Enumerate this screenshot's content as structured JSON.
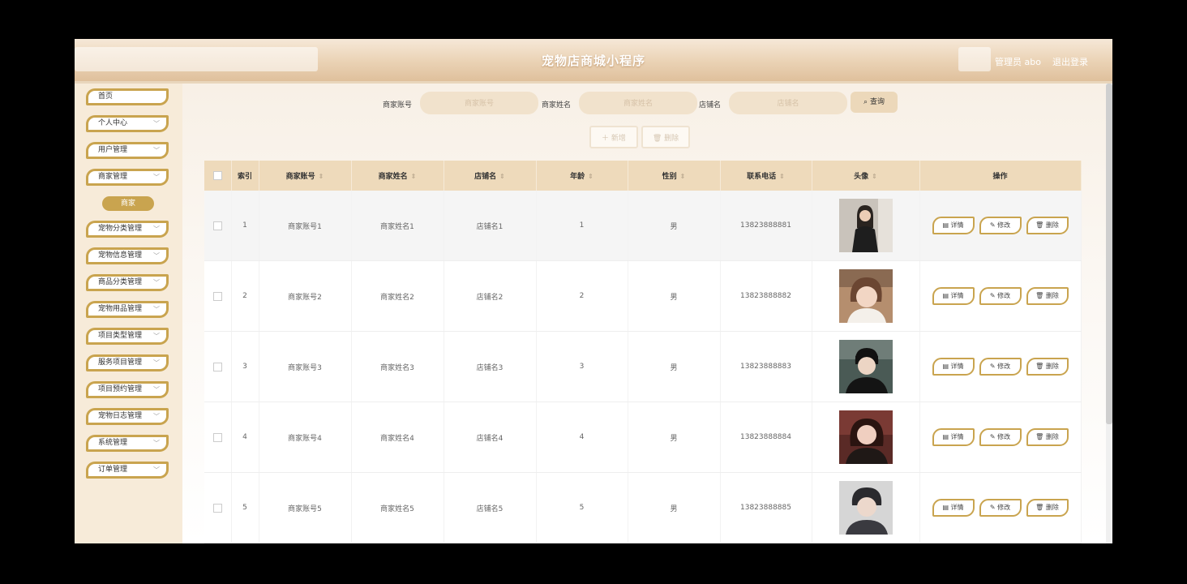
{
  "header": {
    "title": "宠物店商城小程序",
    "user": "管理员 abo",
    "logout": "退出登录"
  },
  "sidebar": {
    "items": [
      {
        "label": "首页",
        "chevron": false
      },
      {
        "label": "个人中心",
        "chevron": true
      },
      {
        "label": "用户管理",
        "chevron": true
      },
      {
        "label": "商家管理",
        "chevron": true
      },
      {
        "label": "宠物分类管理",
        "chevron": true
      },
      {
        "label": "宠物信息管理",
        "chevron": true
      },
      {
        "label": "商品分类管理",
        "chevron": true
      },
      {
        "label": "宠物用品管理",
        "chevron": true
      },
      {
        "label": "项目类型管理",
        "chevron": true
      },
      {
        "label": "服务项目管理",
        "chevron": true
      },
      {
        "label": "项目预约管理",
        "chevron": true
      },
      {
        "label": "宠物日志管理",
        "chevron": true
      },
      {
        "label": "系统管理",
        "chevron": true
      },
      {
        "label": "订单管理",
        "chevron": true
      }
    ],
    "submenu": "商家"
  },
  "search": {
    "fields": [
      {
        "label": "商家账号",
        "placeholder": "商家账号"
      },
      {
        "label": "商家姓名",
        "placeholder": "商家姓名"
      },
      {
        "label": "店铺名",
        "placeholder": "店铺名"
      }
    ],
    "query": "查询"
  },
  "actions": {
    "add": "新增",
    "delete": "删除"
  },
  "table": {
    "columns": [
      "索引",
      "商家账号",
      "商家姓名",
      "店铺名",
      "年龄",
      "性别",
      "联系电话",
      "头像",
      "操作"
    ],
    "rows": [
      {
        "index": "1",
        "account": "商家账号1",
        "name": "商家姓名1",
        "shop": "店铺名1",
        "age": "1",
        "gender": "男",
        "phone": "13823888881"
      },
      {
        "index": "2",
        "account": "商家账号2",
        "name": "商家姓名2",
        "shop": "店铺名2",
        "age": "2",
        "gender": "男",
        "phone": "13823888882"
      },
      {
        "index": "3",
        "account": "商家账号3",
        "name": "商家姓名3",
        "shop": "店铺名3",
        "age": "3",
        "gender": "男",
        "phone": "13823888883"
      },
      {
        "index": "4",
        "account": "商家账号4",
        "name": "商家姓名4",
        "shop": "店铺名4",
        "age": "4",
        "gender": "男",
        "phone": "13823888884"
      },
      {
        "index": "5",
        "account": "商家账号5",
        "name": "商家姓名5",
        "shop": "店铺名5",
        "age": "5",
        "gender": "男",
        "phone": "13823888885"
      }
    ],
    "ops": {
      "detail": "详情",
      "edit": "修改",
      "delete": "删除"
    }
  },
  "colors": {
    "accent": "#c9a44f",
    "header_bg": "#eedabb",
    "sidebar_bg": "#f7ebd9"
  }
}
